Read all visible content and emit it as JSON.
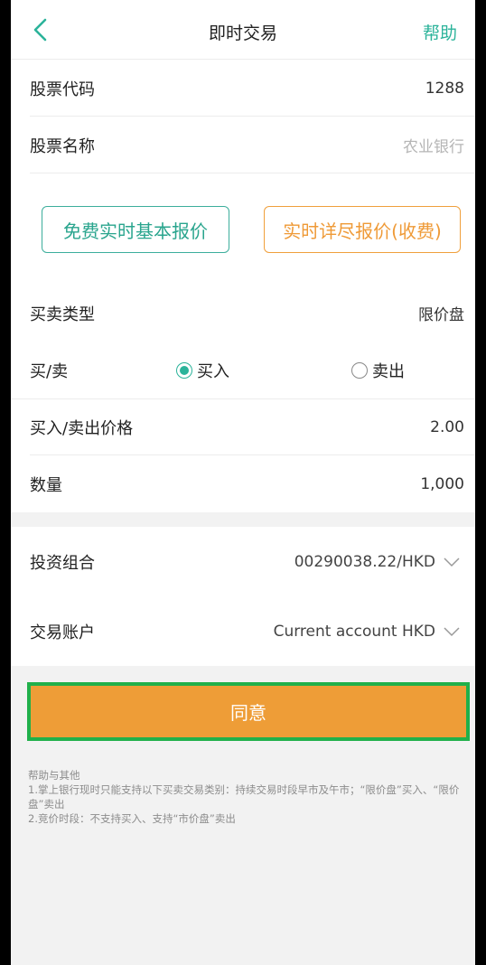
{
  "header": {
    "title": "即时交易",
    "help": "帮助"
  },
  "stock": {
    "code_label": "股票代码",
    "code_value": "1288",
    "name_label": "股票名称",
    "name_placeholder": "农业银行"
  },
  "quotes": {
    "free": "免费实时基本报价",
    "paid": "实时详尽报价(收费)"
  },
  "trade": {
    "type_label": "买卖类型",
    "type_value": "限价盘",
    "side_label": "买/卖",
    "buy": "买入",
    "sell": "卖出",
    "selected": "buy",
    "price_label": "买入/卖出价格",
    "price_value": "2.00",
    "qty_label": "数量",
    "qty_value": "1,000"
  },
  "portfolio": {
    "label": "投资组合",
    "value": "00290038.22/HKD"
  },
  "account": {
    "label": "交易账户",
    "value": "Current account HKD"
  },
  "agree": "同意",
  "notes": {
    "title": "帮助与其他",
    "line1": "1.掌上银行现时只能支持以下买卖交易类别：持续交易时段早市及午市；“限价盘”买入、“限价盘”卖出",
    "line2": "2.竞价时段：不支持买入、支持“市价盘”卖出"
  },
  "colors": {
    "accent": "#2bb39a",
    "orange": "#ee9d37",
    "highlight": "#21b04a"
  }
}
